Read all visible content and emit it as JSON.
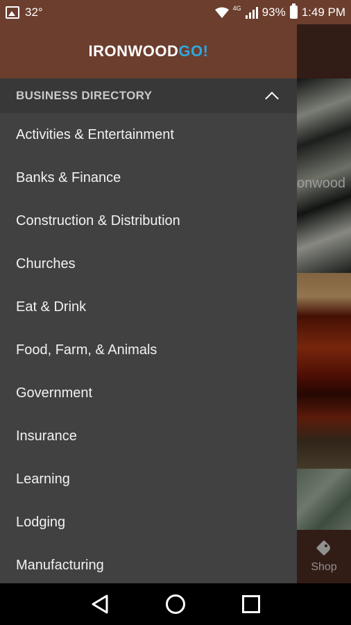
{
  "status_bar": {
    "temperature": "32°",
    "network": "4G",
    "battery": "93%",
    "time": "1:49 PM"
  },
  "app": {
    "logo_main": "IRONWOOD",
    "logo_accent": "GO!",
    "background_photo_label": "onwood",
    "shop_tab_label": "Shop"
  },
  "drawer": {
    "section_title": "BUSINESS DIRECTORY",
    "items": [
      {
        "label": "Activities & Entertainment"
      },
      {
        "label": "Banks & Finance"
      },
      {
        "label": "Construction & Distribution"
      },
      {
        "label": "Churches"
      },
      {
        "label": "Eat & Drink"
      },
      {
        "label": "Food, Farm, & Animals"
      },
      {
        "label": "Government"
      },
      {
        "label": "Insurance"
      },
      {
        "label": "Learning"
      },
      {
        "label": "Lodging"
      },
      {
        "label": "Manufacturing"
      }
    ]
  },
  "colors": {
    "brand_brown": "#6b3e2e",
    "drawer_bg": "#414141",
    "logo_accent": "#2ea8e0"
  }
}
